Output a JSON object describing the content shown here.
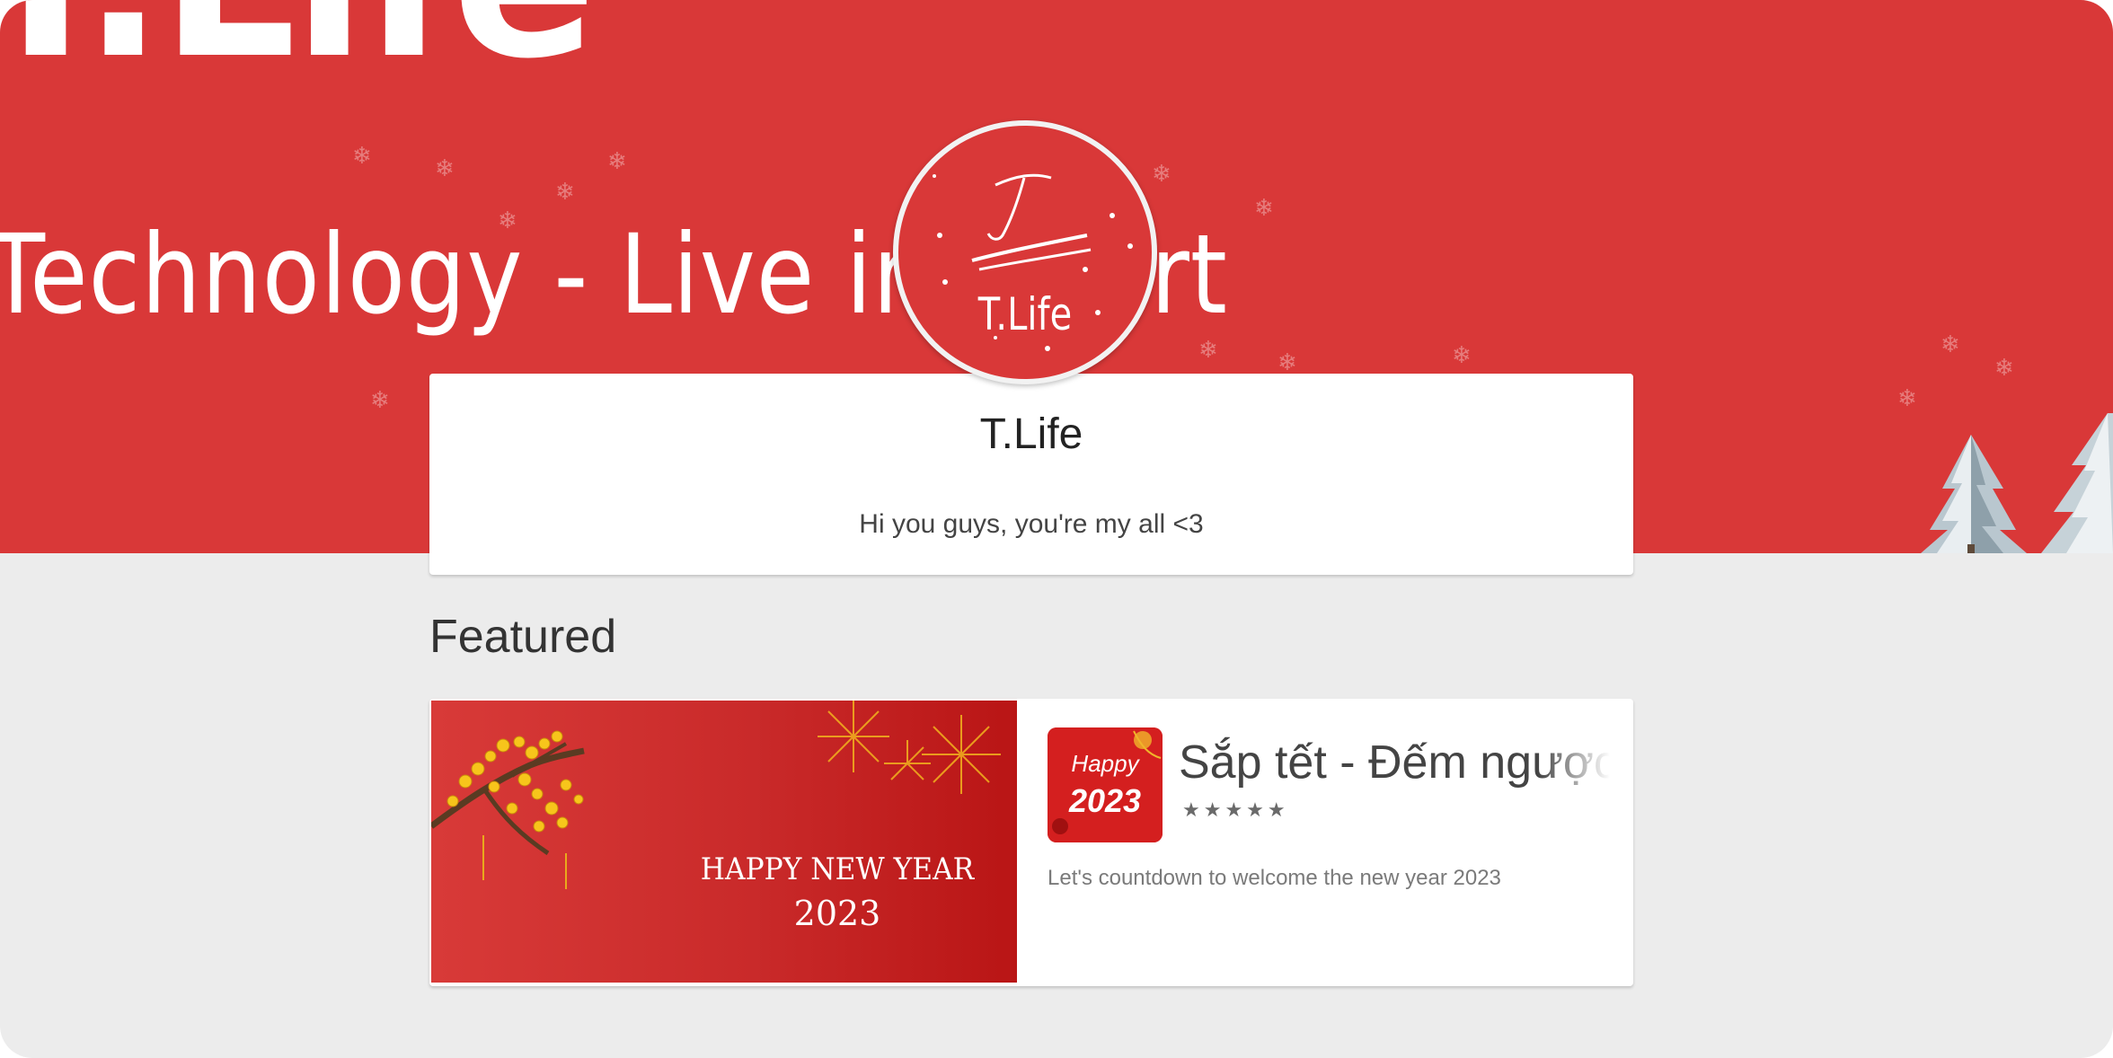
{
  "banner": {
    "big_title": "T.Life",
    "tagline": "Technology - Live in Effort"
  },
  "logo": {
    "text": "T.Life",
    "monogram": "T"
  },
  "profile": {
    "name": "T.Life",
    "bio": "Hi you guys, you're my all <3"
  },
  "featured": {
    "section_title": "Featured",
    "banner_line1": "HAPPY NEW YEAR",
    "banner_line2": "2023",
    "app_icon_top": "Happy",
    "app_icon_year": "2023",
    "app_title": "Sắp tết - Đếm ngược",
    "rating_stars": "★★★★★",
    "description": "Let's countdown to welcome the new year 2023"
  },
  "colors": {
    "brand_red": "#d93838",
    "page_bg": "#ececec"
  }
}
